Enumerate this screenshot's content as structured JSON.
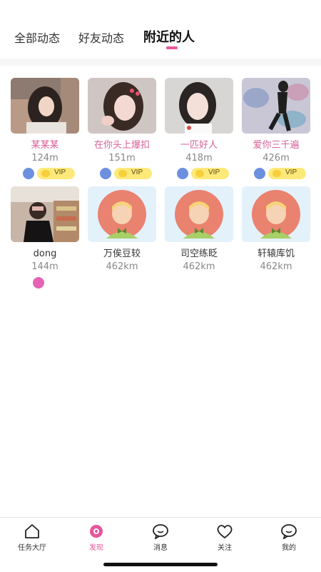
{
  "tabs": [
    {
      "label": "全部动态"
    },
    {
      "label": "好友动态"
    },
    {
      "label": "附近的人"
    }
  ],
  "active_tab": 2,
  "people": [
    {
      "name": "某某某",
      "distance": "124m",
      "vip_label": "VIP"
    },
    {
      "name": "在你头上爆扣",
      "distance": "151m",
      "vip_label": "VIP"
    },
    {
      "name": "一匹好人",
      "distance": "418m",
      "vip_label": "VIP"
    },
    {
      "name": "爱你三千遍",
      "distance": "426m",
      "vip_label": "VIP"
    },
    {
      "name": "dong",
      "distance": "144m"
    },
    {
      "name": "万俟豆较",
      "distance": "462km"
    },
    {
      "name": "司空练眨",
      "distance": "462km"
    },
    {
      "name": "轩辕库饥",
      "distance": "462km"
    }
  ],
  "bottom_nav": [
    {
      "label": "任务大厅",
      "icon": "home-icon"
    },
    {
      "label": "发现",
      "icon": "discover-icon"
    },
    {
      "label": "消息",
      "icon": "message-icon"
    },
    {
      "label": "关注",
      "icon": "heart-icon"
    },
    {
      "label": "我的",
      "icon": "profile-icon"
    }
  ],
  "colors": {
    "accent": "#e8559a",
    "name_pink": "#d8609a",
    "vip": "#fde97a",
    "male": "#6c8fe0"
  }
}
